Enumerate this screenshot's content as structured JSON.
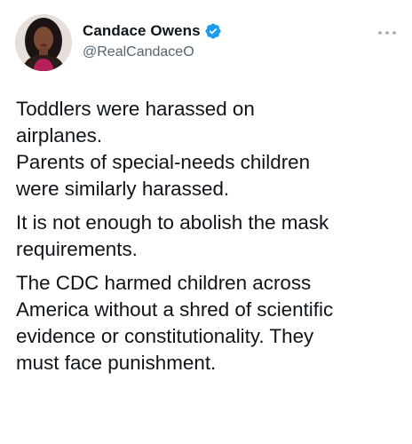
{
  "author": {
    "display_name": "Candace Owens",
    "handle": "@RealCandaceO",
    "verified": true,
    "avatar_icon": "avatar-photo"
  },
  "actions": {
    "more_icon": "ellipsis-icon"
  },
  "tweet": {
    "paragraphs": [
      "Toddlers were harassed on\nairplanes.\nParents of special-needs children\nwere similarly harassed.",
      "It is not enough to abolish the mask\nrequirements.",
      "The CDC harmed children across\nAmerica without a shred of scientific\nevidence or constitutionality. They\nmust face punishment."
    ]
  },
  "colors": {
    "text": "#0f1419",
    "secondary": "#536471",
    "verified_blue": "#1d9bf0",
    "more_dots": "#a0a8b0"
  }
}
